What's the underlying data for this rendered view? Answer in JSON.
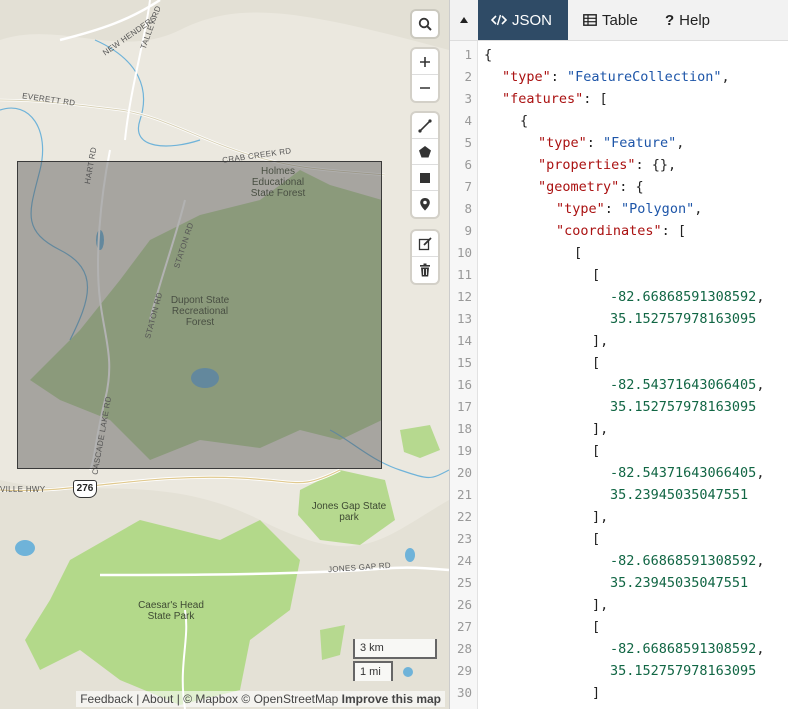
{
  "map": {
    "labels": {
      "holmes_forest": "Holmes\nEducational\nState Forest",
      "dupont_forest": "Dupont State\nRecreational\nForest",
      "jones_gap": "Jones Gap State\npark",
      "caesars_head": "Caesar's Head\nState Park",
      "crab_creek_rd": "CRAB CREEK RD",
      "everett_rd": "EVERETT RD",
      "new_hendersonville": "NEW HENDERS",
      "talley_rd": "TALLEY RD",
      "staton_rd_1": "STATON RD",
      "staton_rd_2": "STATON RD",
      "cascade_lake_rd": "CASCADE LAKE RD",
      "jones_gap_rd": "JONES GAP RD",
      "ville_hwy": "VILLE HWY",
      "hart_rd": "HART RD",
      "route_shield": "276"
    },
    "controls": {
      "search_icon": "search-icon",
      "zoom_in_icon": "plus-icon",
      "zoom_out_icon": "minus-icon",
      "draw_line_icon": "line-icon",
      "draw_polygon_icon": "pentagon-icon",
      "draw_rectangle_icon": "square-icon",
      "draw_marker_icon": "marker-icon",
      "edit_icon": "edit-icon",
      "delete_icon": "trash-icon"
    },
    "scale": {
      "km": "3 km",
      "mi": "1 mi"
    },
    "attribution": {
      "feedback": "Feedback",
      "sep1": " | ",
      "about": "About",
      "sep2": " | ",
      "mapbox": "© Mapbox",
      "osm": "© OpenStreetMap",
      "improve": "Improve this map"
    }
  },
  "panel": {
    "tabs": [
      {
        "label": "JSON",
        "icon": "code-icon",
        "active": true
      },
      {
        "label": "Table",
        "icon": "table-icon",
        "active": false
      },
      {
        "label": "Help",
        "icon": "question-icon",
        "active": false
      }
    ],
    "colors": {
      "active_tab": "#2f4b66",
      "key": "#a11111",
      "string": "#1d55a8",
      "number": "#116644",
      "selection_fill": "#555555"
    },
    "lines": [
      {
        "n": "1",
        "indent": 0,
        "parts": [
          [
            "p",
            "{"
          ]
        ]
      },
      {
        "n": "2",
        "indent": 1,
        "parts": [
          [
            "k",
            "\"type\""
          ],
          [
            "p",
            ": "
          ],
          [
            "s",
            "\"FeatureCollection\""
          ],
          [
            "p",
            ","
          ]
        ]
      },
      {
        "n": "3",
        "indent": 1,
        "parts": [
          [
            "k",
            "\"features\""
          ],
          [
            "p",
            ": ["
          ]
        ]
      },
      {
        "n": "4",
        "indent": 2,
        "parts": [
          [
            "p",
            "{"
          ]
        ]
      },
      {
        "n": "5",
        "indent": 3,
        "parts": [
          [
            "k",
            "\"type\""
          ],
          [
            "p",
            ": "
          ],
          [
            "s",
            "\"Feature\""
          ],
          [
            "p",
            ","
          ]
        ]
      },
      {
        "n": "6",
        "indent": 3,
        "parts": [
          [
            "k",
            "\"properties\""
          ],
          [
            "p",
            ": {},"
          ]
        ]
      },
      {
        "n": "7",
        "indent": 3,
        "parts": [
          [
            "k",
            "\"geometry\""
          ],
          [
            "p",
            ": {"
          ]
        ]
      },
      {
        "n": "8",
        "indent": 4,
        "parts": [
          [
            "k",
            "\"type\""
          ],
          [
            "p",
            ": "
          ],
          [
            "s",
            "\"Polygon\""
          ],
          [
            "p",
            ","
          ]
        ]
      },
      {
        "n": "9",
        "indent": 4,
        "parts": [
          [
            "k",
            "\"coordinates\""
          ],
          [
            "p",
            ": ["
          ]
        ]
      },
      {
        "n": "10",
        "indent": 5,
        "parts": [
          [
            "p",
            "["
          ]
        ]
      },
      {
        "n": "11",
        "indent": 6,
        "parts": [
          [
            "p",
            "["
          ]
        ]
      },
      {
        "n": "12",
        "indent": 7,
        "parts": [
          [
            "n",
            "-82.66868591308592"
          ],
          [
            "p",
            ","
          ]
        ]
      },
      {
        "n": "13",
        "indent": 7,
        "parts": [
          [
            "n",
            "35.152757978163095"
          ]
        ]
      },
      {
        "n": "14",
        "indent": 6,
        "parts": [
          [
            "p",
            "],"
          ]
        ]
      },
      {
        "n": "15",
        "indent": 6,
        "parts": [
          [
            "p",
            "["
          ]
        ]
      },
      {
        "n": "16",
        "indent": 7,
        "parts": [
          [
            "n",
            "-82.54371643066405"
          ],
          [
            "p",
            ","
          ]
        ]
      },
      {
        "n": "17",
        "indent": 7,
        "parts": [
          [
            "n",
            "35.152757978163095"
          ]
        ]
      },
      {
        "n": "18",
        "indent": 6,
        "parts": [
          [
            "p",
            "],"
          ]
        ]
      },
      {
        "n": "19",
        "indent": 6,
        "parts": [
          [
            "p",
            "["
          ]
        ]
      },
      {
        "n": "20",
        "indent": 7,
        "parts": [
          [
            "n",
            "-82.54371643066405"
          ],
          [
            "p",
            ","
          ]
        ]
      },
      {
        "n": "21",
        "indent": 7,
        "parts": [
          [
            "n",
            "35.23945035047551"
          ]
        ]
      },
      {
        "n": "22",
        "indent": 6,
        "parts": [
          [
            "p",
            "],"
          ]
        ]
      },
      {
        "n": "23",
        "indent": 6,
        "parts": [
          [
            "p",
            "["
          ]
        ]
      },
      {
        "n": "24",
        "indent": 7,
        "parts": [
          [
            "n",
            "-82.66868591308592"
          ],
          [
            "p",
            ","
          ]
        ]
      },
      {
        "n": "25",
        "indent": 7,
        "parts": [
          [
            "n",
            "35.23945035047551"
          ]
        ]
      },
      {
        "n": "26",
        "indent": 6,
        "parts": [
          [
            "p",
            "],"
          ]
        ]
      },
      {
        "n": "27",
        "indent": 6,
        "parts": [
          [
            "p",
            "["
          ]
        ]
      },
      {
        "n": "28",
        "indent": 7,
        "parts": [
          [
            "n",
            "-82.66868591308592"
          ],
          [
            "p",
            ","
          ]
        ]
      },
      {
        "n": "29",
        "indent": 7,
        "parts": [
          [
            "n",
            "35.152757978163095"
          ]
        ]
      },
      {
        "n": "30",
        "indent": 6,
        "parts": [
          [
            "p",
            "]"
          ]
        ]
      }
    ]
  }
}
